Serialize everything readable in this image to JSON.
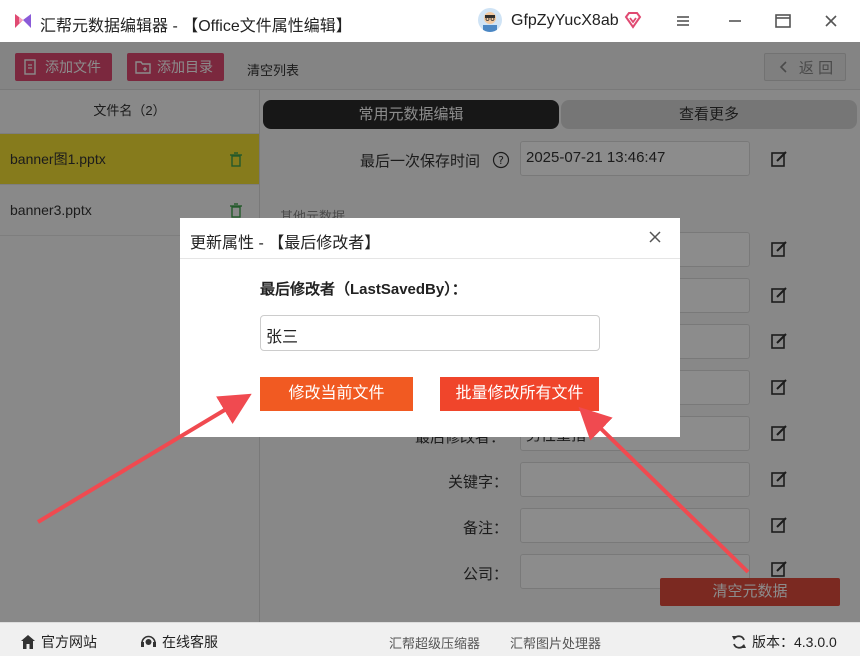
{
  "window": {
    "title": "汇帮元数据编辑器 - 【Office文件属性编辑】",
    "username": "GfpZyYucX8ab"
  },
  "toolbar": {
    "add_file": "添加文件",
    "add_dir": "添加目录",
    "clear_list": "清空列表",
    "back": "返 回"
  },
  "sidebar": {
    "header": "文件名（2）",
    "files": [
      {
        "name": "banner图1.pptx"
      },
      {
        "name": "banner3.pptx"
      }
    ]
  },
  "tabs": {
    "common": "常用元数据编辑",
    "more": "查看更多"
  },
  "fields": {
    "last_saved_time": {
      "label": "最后一次保存时间",
      "value": "2025-07-21 13:46:47"
    },
    "other_section": "其他元数据",
    "last_author_label": "最后修改者：",
    "last_author_value": "男性重指",
    "keywords": "关键字：",
    "remarks": "备注：",
    "company": "公司："
  },
  "clear_metadata": "清空元数据",
  "statusbar": {
    "website": "官方网站",
    "service": "在线客服",
    "compressor": "汇帮超级压缩器",
    "image_tool": "汇帮图片处理器",
    "version": "版本：4.3.0.0"
  },
  "dialog": {
    "title": "更新属性 - 【最后修改者】",
    "field_label": "最后修改者（LastSavedBy）：",
    "field_value": "张三",
    "modify_current": "修改当前文件",
    "modify_all": "批量修改所有文件"
  },
  "colors": {
    "accent_pink": "#e04a72",
    "active_file": "#f5e033",
    "dialog_button": "#f15a22",
    "arrow": "#f04a50"
  }
}
